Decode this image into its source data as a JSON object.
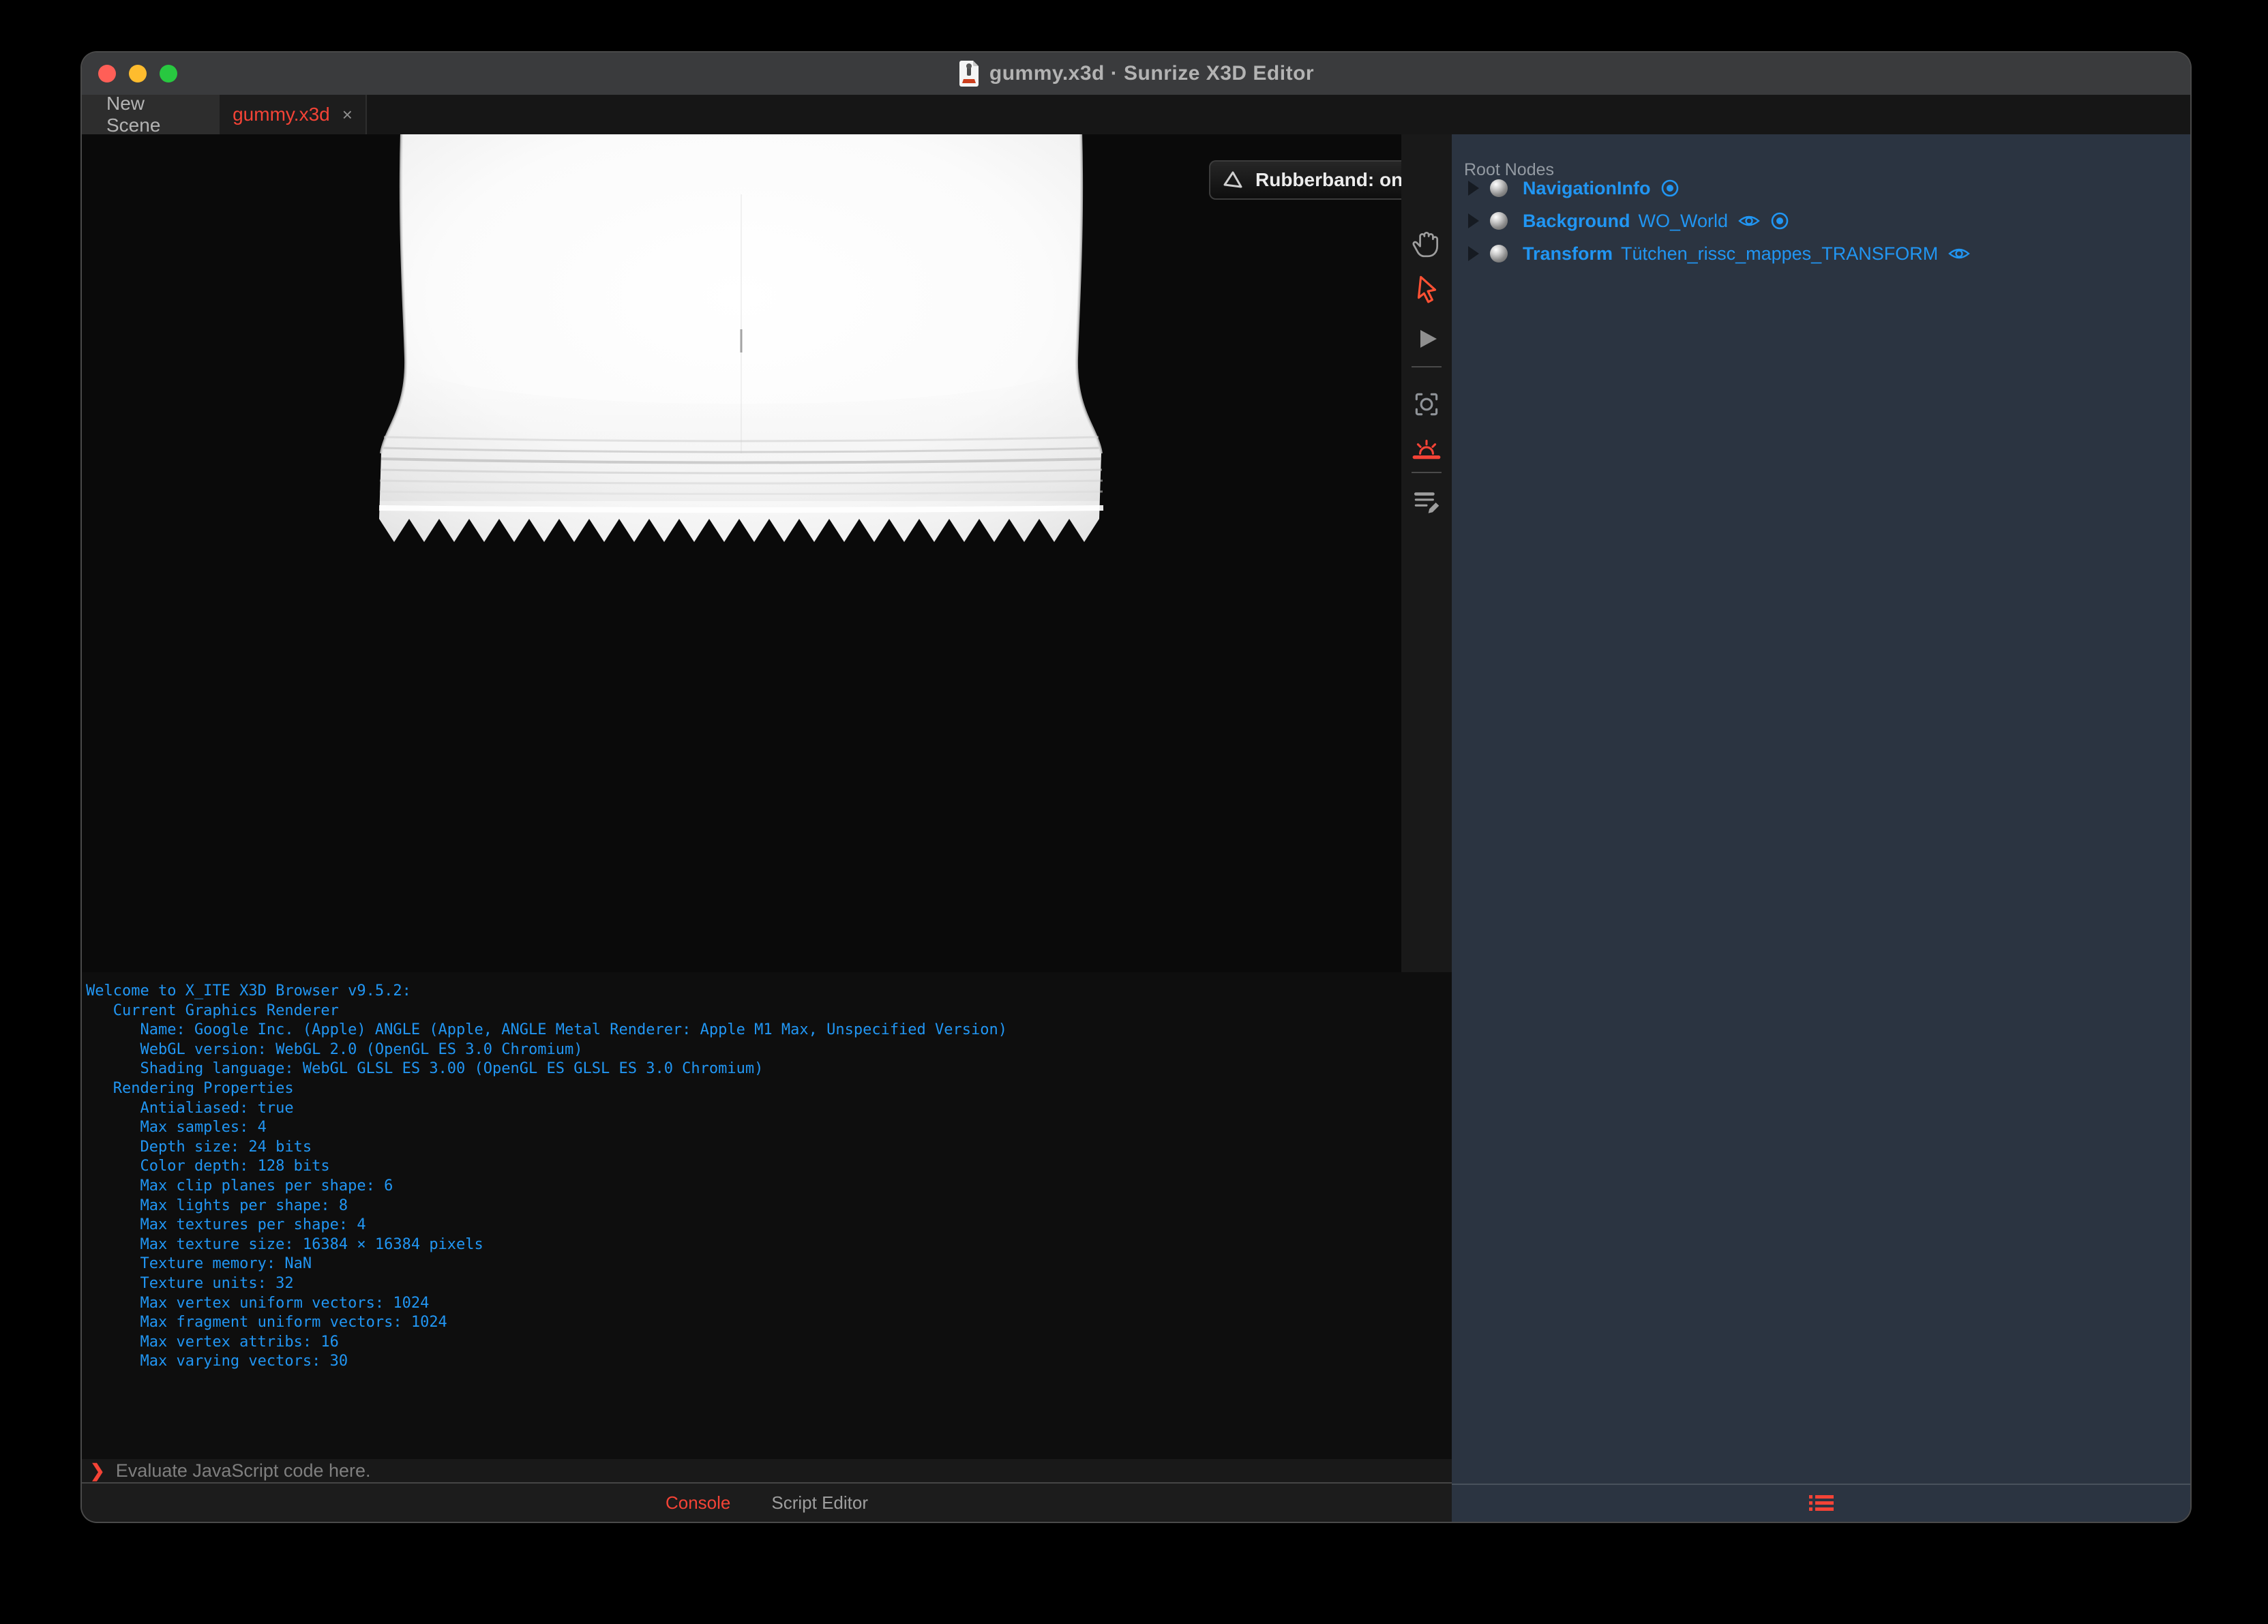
{
  "window": {
    "title": "gummy.x3d · Sunrize X3D Editor",
    "traffic_lights": [
      "close",
      "minimize",
      "zoom"
    ]
  },
  "tabs": [
    {
      "label": "New Scene",
      "close": ""
    },
    {
      "label": "gummy.x3d",
      "close": "×"
    }
  ],
  "viewport": {
    "rubberband_label": "Rubberband: on",
    "toolbar_icons": [
      "hand-pan",
      "arrow-select",
      "play",
      "camera-viewframe",
      "sunrise-light",
      "script-edit"
    ],
    "console_side_icons": [
      "clear-close",
      "trash-delete"
    ]
  },
  "outline": {
    "header": "Root Nodes",
    "nodes": [
      {
        "type": "NavigationInfo",
        "name": "",
        "icons": [
          "bind"
        ]
      },
      {
        "type": "Background",
        "name": "WO_World",
        "icons": [
          "eye",
          "bind"
        ]
      },
      {
        "type": "Transform",
        "name": "Tütchen_rissc_mappes_TRANSFORM",
        "icons": [
          "eye"
        ]
      }
    ]
  },
  "console": {
    "lines": [
      "Welcome to X_ITE X3D Browser v9.5.2:",
      "   Current Graphics Renderer",
      "      Name: Google Inc. (Apple) ANGLE (Apple, ANGLE Metal Renderer: Apple M1 Max, Unspecified Version)",
      "      WebGL version: WebGL 2.0 (OpenGL ES 3.0 Chromium)",
      "      Shading language: WebGL GLSL ES 3.00 (OpenGL ES GLSL ES 3.0 Chromium)",
      "   Rendering Properties",
      "      Antialiased: true",
      "      Max samples: 4",
      "      Depth size: 24 bits",
      "      Color depth: 128 bits",
      "      Max clip planes per shape: 6",
      "      Max lights per shape: 8",
      "      Max textures per shape: 4",
      "      Max texture size: 16384 × 16384 pixels",
      "      Texture memory: NaN",
      "      Texture units: 32",
      "      Max vertex uniform vectors: 1024",
      "      Max fragment uniform vectors: 1024",
      "      Max vertex attribs: 16",
      "      Max varying vectors: 30"
    ],
    "prompt_symbol": "❯",
    "prompt_placeholder": "Evaluate JavaScript code here.",
    "tabs": [
      {
        "label": "Console",
        "active": true
      },
      {
        "label": "Script Editor",
        "active": false
      }
    ]
  },
  "colors": {
    "accent_red": "#f44336",
    "console_blue": "#2196f3",
    "tree_blue": "#2196f3",
    "panel_bg": "#2b3441",
    "titlebar_bg": "#3a3b3d",
    "traffic_red": "#ff5f57",
    "traffic_yellow": "#febc2e",
    "traffic_green": "#28c840"
  }
}
